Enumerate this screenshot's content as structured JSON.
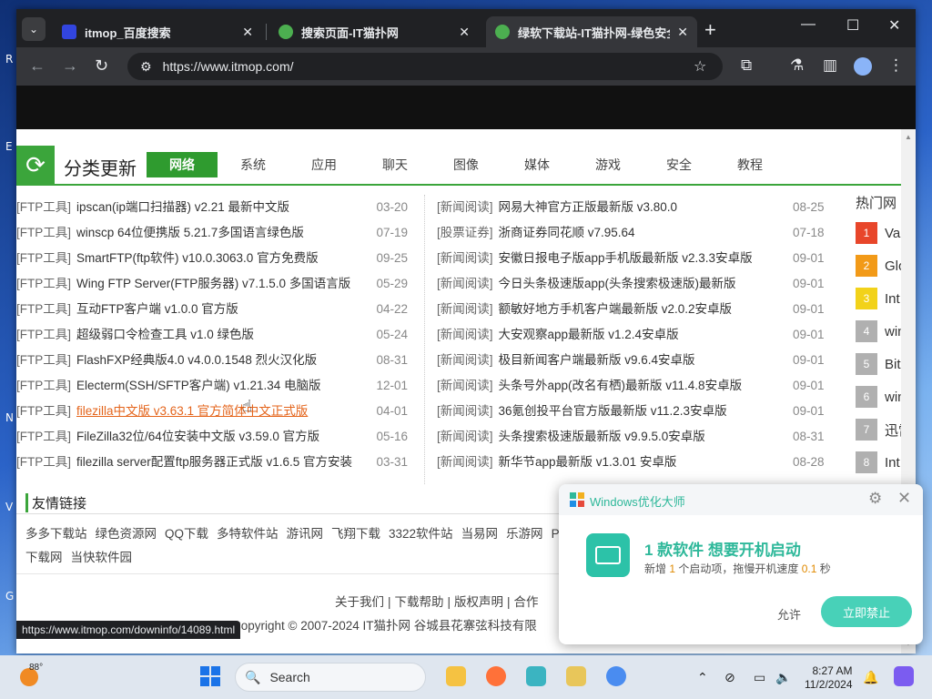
{
  "desktop": {
    "edge_letters": [
      "R",
      "E",
      "N",
      "V",
      "G"
    ]
  },
  "browser": {
    "tabs": [
      {
        "title": "itmop_百度搜索",
        "favicon_color": "#3245df"
      },
      {
        "title": "搜索页面-IT猫扑网",
        "favicon_color": "#4caf50"
      },
      {
        "title": "绿软下载站-IT猫扑网-绿色安全",
        "favicon_color": "#4caf50"
      }
    ],
    "url": "https://www.itmop.com/",
    "status_url": "https://www.itmop.com/downinfo/14089.html"
  },
  "category": {
    "title": "分类更新",
    "tabs": [
      "网络",
      "系统",
      "应用",
      "聊天",
      "图像",
      "媒体",
      "游戏",
      "安全",
      "教程"
    ],
    "active_tab": "网络"
  },
  "left_list": [
    {
      "tag": "[FTP工具]",
      "name": "ipscan(ip端口扫描器) v2.21 最新中文版",
      "date": "03-20"
    },
    {
      "tag": "[FTP工具]",
      "name": "winscp 64位便携版 5.21.7多国语言绿色版",
      "date": "07-19"
    },
    {
      "tag": "[FTP工具]",
      "name": "SmartFTP(ftp软件) v10.0.3063.0 官方免费版",
      "date": "09-25"
    },
    {
      "tag": "[FTP工具]",
      "name": "Wing FTP Server(FTP服务器) v7.1.5.0 多国语言版",
      "date": "05-29"
    },
    {
      "tag": "[FTP工具]",
      "name": "互动FTP客户端 v1.0.0 官方版",
      "date": "04-22"
    },
    {
      "tag": "[FTP工具]",
      "name": "超级弱口令检查工具 v1.0 绿色版",
      "date": "05-24"
    },
    {
      "tag": "[FTP工具]",
      "name": "FlashFXP经典版4.0 v4.0.0.1548 烈火汉化版",
      "date": "08-31"
    },
    {
      "tag": "[FTP工具]",
      "name": "Electerm(SSH/SFTP客户端) v1.21.34 电脑版",
      "date": "12-01"
    },
    {
      "tag": "[FTP工具]",
      "name": "filezilla中文版 v3.63.1 官方简体中文正式版",
      "date": "04-01",
      "highlight": true
    },
    {
      "tag": "[FTP工具]",
      "name": "FileZilla32位/64位安装中文版 v3.59.0 官方版",
      "date": "05-16"
    },
    {
      "tag": "[FTP工具]",
      "name": "filezilla server配置ftp服务器正式版 v1.6.5 官方安装",
      "date": "03-31"
    }
  ],
  "right_list": [
    {
      "tag": "[新闻阅读]",
      "name": "网易大神官方正版最新版 v3.80.0",
      "date": "08-25"
    },
    {
      "tag": "[股票证券]",
      "name": "浙商证券同花顺 v7.95.64",
      "date": "07-18"
    },
    {
      "tag": "[新闻阅读]",
      "name": "安徽日报电子版app手机版最新版 v2.3.3安卓版",
      "date": "09-01"
    },
    {
      "tag": "[新闻阅读]",
      "name": "今日头条极速版app(头条搜索极速版)最新版",
      "date": "09-01"
    },
    {
      "tag": "[新闻阅读]",
      "name": "额敏好地方手机客户端最新版 v2.0.2安卓版",
      "date": "09-01"
    },
    {
      "tag": "[新闻阅读]",
      "name": "大安观察app最新版 v1.2.4安卓版",
      "date": "09-01"
    },
    {
      "tag": "[新闻阅读]",
      "name": "极目新闻客户端最新版 v9.6.4安卓版",
      "date": "09-01"
    },
    {
      "tag": "[新闻阅读]",
      "name": "头条号外app(改名有栖)最新版 v11.4.8安卓版",
      "date": "09-01"
    },
    {
      "tag": "[新闻阅读]",
      "name": "36氪创投平台官方版最新版 v11.2.3安卓版",
      "date": "09-01"
    },
    {
      "tag": "[新闻阅读]",
      "name": "头条搜索极速版最新版 v9.9.5.0安卓版",
      "date": "08-31"
    },
    {
      "tag": "[新闻阅读]",
      "name": "新华节app最新版 v1.3.01 安卓版",
      "date": "08-28"
    }
  ],
  "hot": {
    "title": "热门网",
    "items": [
      {
        "num": "1",
        "text": "Va",
        "color": "#e8462a"
      },
      {
        "num": "2",
        "text": "Glo",
        "color": "#f29a18"
      },
      {
        "num": "3",
        "text": "Int",
        "color": "#f2d21a"
      },
      {
        "num": "4",
        "text": "win",
        "color": "#b0b0b0"
      },
      {
        "num": "5",
        "text": "Bit",
        "color": "#b0b0b0"
      },
      {
        "num": "6",
        "text": "win",
        "color": "#b0b0b0"
      },
      {
        "num": "7",
        "text": "迅雷",
        "color": "#b0b0b0"
      },
      {
        "num": "8",
        "text": "Int",
        "color": "#b0b0b0"
      }
    ]
  },
  "friend_links": {
    "title": "友情链接",
    "items": [
      "多多下载站",
      "绿色资源网",
      "QQ下载",
      "多特软件站",
      "游讯网",
      "飞翔下载",
      "3322软件站",
      "当易网",
      "乐游网",
      "PC下载网",
      "当快软件园"
    ]
  },
  "footer": {
    "links": [
      "关于我们",
      "|",
      "下载帮助",
      "|",
      "版权声明",
      "|",
      "合作"
    ],
    "copyright": "Copyright © 2007-2024  IT猫扑网 谷城县花寨弦科技有限"
  },
  "popup": {
    "app_name": "Windows优化大师",
    "main_text": "1 款软件 想要开机启动",
    "sub_prefix": "新增",
    "sub_count": "1",
    "sub_middle": "个启动项，拖慢开机速度",
    "sub_speed": "0.1",
    "sub_suffix": "秒",
    "allow_label": "允许",
    "block_label": "立即禁止"
  },
  "taskbar": {
    "temperature": "88°",
    "search_label": "Search",
    "time": "8:27 AM",
    "date": "11/2/2024"
  }
}
